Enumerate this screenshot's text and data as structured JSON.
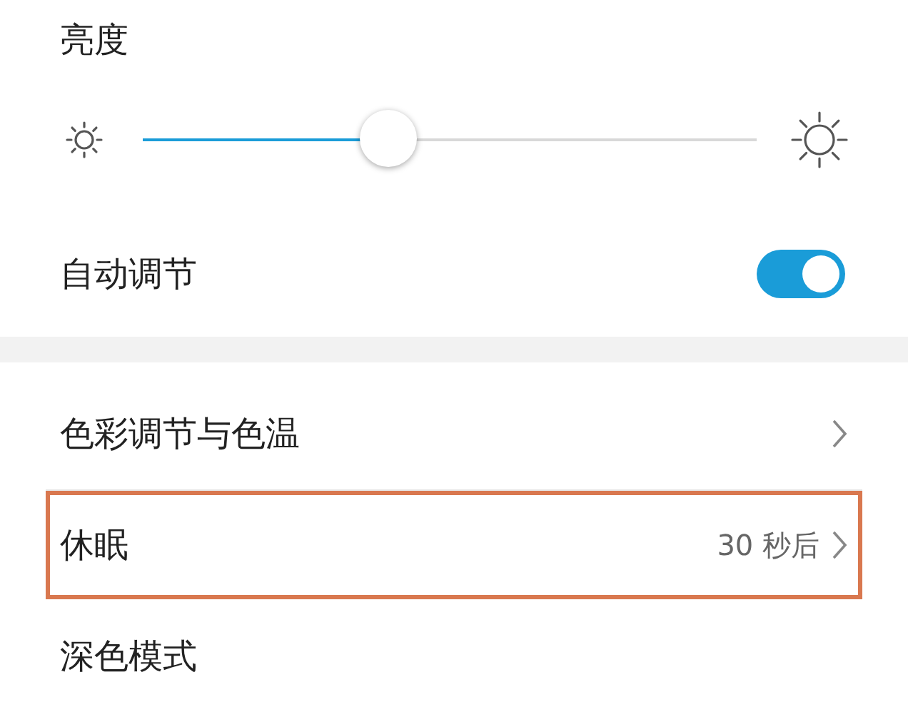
{
  "brightness": {
    "title": "亮度",
    "level": 0.4
  },
  "auto_adjust": {
    "label": "自动调节",
    "on": true
  },
  "items": [
    {
      "label": "色彩调节与色温",
      "highlighted": false
    },
    {
      "label": "休眠",
      "value": "30 秒后",
      "highlighted": true
    },
    {
      "label": "深色模式",
      "highlighted": false
    }
  ]
}
